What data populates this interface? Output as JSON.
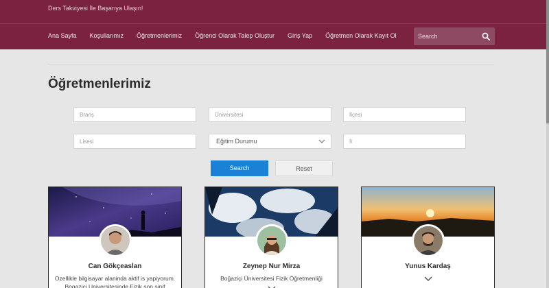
{
  "header": {
    "tagline": "Ders Takviyesi İle Başarıya Ulaşın!",
    "nav": [
      "Ana Sayfa",
      "Koşullarımız",
      "Öğretmenlerimiz",
      "Öğrenci Olarak Talep Oluştur",
      "Giriş Yap",
      "Öğretmen Olarak Kayıt Ol"
    ],
    "search_placeholder": "Search",
    "color": "#7a2240"
  },
  "main": {
    "title": "Öğretmenlerimiz",
    "filters": {
      "brans_placeholder": "Branş",
      "universite_placeholder": "Üniversitesi",
      "ilce_placeholder": "İlçesi",
      "lise_placeholder": "Lisesi",
      "egitim_durumu_selected": "Eğitim Durumu",
      "il_placeholder": "İl"
    },
    "search_label": "Search",
    "reset_label": "Reset",
    "accent": "#1a81d6"
  },
  "teachers": [
    {
      "name": "Can Gökçeaslan",
      "line1": "Ozellikle bilgisayar alaninda aktif is yapiyorum.",
      "line2": "Bogazici Universitesinde Fizik son sinif"
    },
    {
      "name": "Zeynep Nur Mirza",
      "line1": "Boğaziçi Üniversitesi Fizik Öğretmenliği",
      "line2": ""
    },
    {
      "name": "Yunus Kardaş",
      "line1": "",
      "line2": ""
    }
  ]
}
